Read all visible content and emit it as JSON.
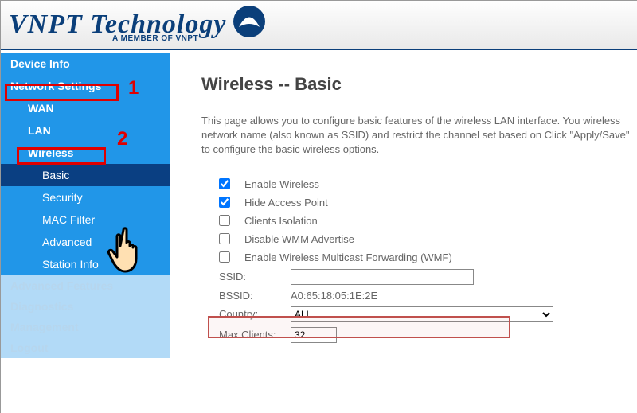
{
  "header": {
    "brand_main": "VNPT Technology",
    "brand_sub": "A MEMBER OF VNPT"
  },
  "sidebar": {
    "device_info": "Device Info",
    "network_settings": "Network Settings",
    "wan": "WAN",
    "lan": "LAN",
    "wireless": "Wireless",
    "basic": "Basic",
    "security": "Security",
    "mac_filter": "MAC Filter",
    "advanced": "Advanced",
    "station_info": "Station Info",
    "advanced_features": "Advanced Features",
    "diagnostics": "Diagnostics",
    "management": "Management",
    "logout": "Logout"
  },
  "main": {
    "title": "Wireless -- Basic",
    "intro": "This page allows you to configure basic features of the wireless LAN interface. You wireless network name (also known as SSID) and restrict the channel set based on Click \"Apply/Save\" to configure the basic wireless options.",
    "enable_wireless": "Enable Wireless",
    "hide_ap": "Hide Access Point",
    "clients_isolation": "Clients Isolation",
    "disable_wmm": "Disable WMM Advertise",
    "enable_wmf": "Enable Wireless Multicast Forwarding (WMF)",
    "ssid_label": "SSID:",
    "ssid_value": "",
    "bssid_label": "BSSID:",
    "bssid_value": "A0:65:18:05:1E:2E",
    "country_label": "Country:",
    "country_value": "ALL",
    "max_clients_label": "Max Clients:",
    "max_clients_value": "32"
  },
  "annotations": {
    "num1": "1",
    "num2": "2"
  }
}
